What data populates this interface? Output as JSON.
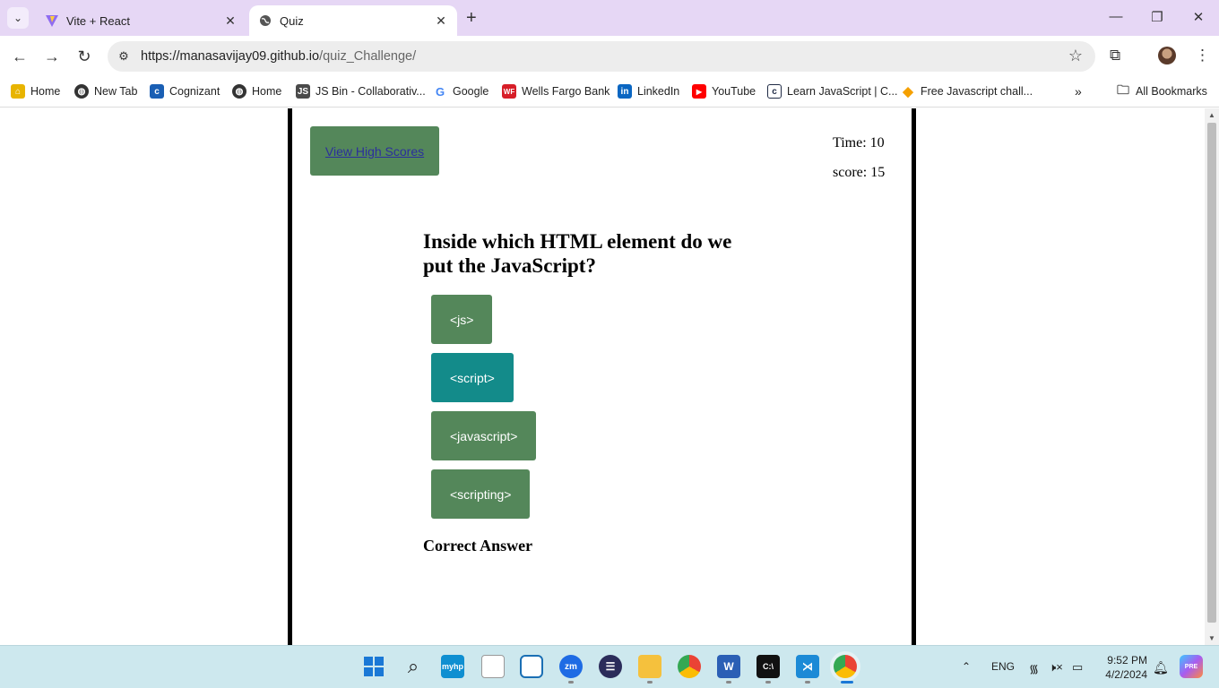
{
  "browser": {
    "tabs": [
      {
        "title": "Vite + React",
        "icon": "vite-icon",
        "active": false
      },
      {
        "title": "Quiz",
        "icon": "globe-icon",
        "active": true
      }
    ],
    "url_host": "https://manasavijay09.github.io",
    "url_path": "/quiz_Challenge/",
    "bookmarks": [
      {
        "label": "Home",
        "icon": "home-bookmark-icon"
      },
      {
        "label": "New Tab",
        "icon": "globe-icon"
      },
      {
        "label": "Cognizant",
        "icon": "cognizant-icon"
      },
      {
        "label": "Home",
        "icon": "globe-icon"
      },
      {
        "label": "JS Bin - Collaborativ...",
        "icon": "jsbin-icon"
      },
      {
        "label": "Google",
        "icon": "google-icon"
      },
      {
        "label": "Wells Fargo Bank",
        "icon": "wells-fargo-icon"
      },
      {
        "label": "LinkedIn",
        "icon": "linkedin-icon"
      },
      {
        "label": "YouTube",
        "icon": "youtube-icon"
      },
      {
        "label": "Learn JavaScript | C...",
        "icon": "codecademy-icon"
      },
      {
        "label": "Free Javascript chall...",
        "icon": "diamond-icon"
      }
    ],
    "all_bookmarks": "All Bookmarks"
  },
  "quiz": {
    "high_scores_link": "View High Scores",
    "time_label": "Time: 10",
    "score_label": "score: 15",
    "question": "Inside which HTML element do we put the JavaScript?",
    "answers": [
      {
        "label": "<js>",
        "selected": false
      },
      {
        "label": "<script>",
        "selected": true
      },
      {
        "label": "<javascript>",
        "selected": false
      },
      {
        "label": "<scripting>",
        "selected": false
      }
    ],
    "result": "Correct Answer",
    "colors": {
      "button": "#54875a",
      "selected": "#138b8a",
      "link": "#2b2f9c"
    }
  },
  "taskbar": {
    "language": "ENG",
    "time": "9:52 PM",
    "date": "4/2/2024"
  }
}
